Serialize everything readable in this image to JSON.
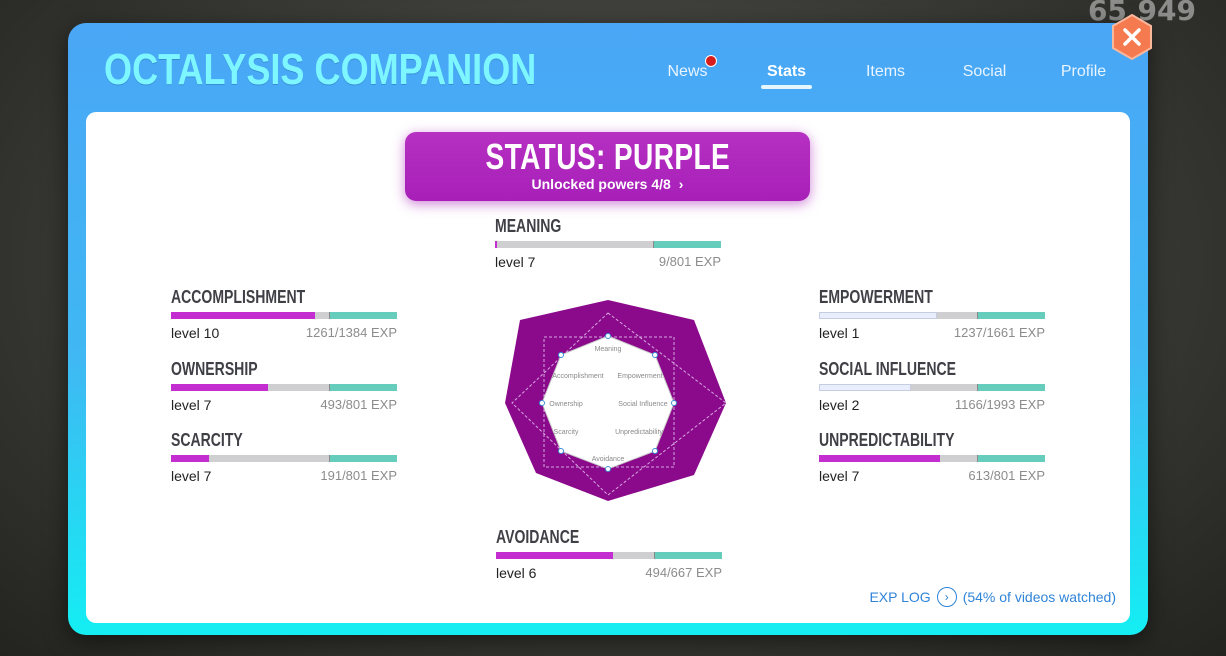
{
  "background": {
    "score": "65,949"
  },
  "header": {
    "title": "OCTALYSIS COMPANION",
    "tabs": [
      {
        "label": "News",
        "notification": true
      },
      {
        "label": "Stats",
        "active": true
      },
      {
        "label": "Items"
      },
      {
        "label": "Social"
      },
      {
        "label": "Profile"
      }
    ],
    "close_icon": "close-icon"
  },
  "status": {
    "title": "STATUS: PURPLE",
    "subtitle": "Unlocked powers 4/8",
    "color": "#b630c2"
  },
  "stats": {
    "meaning": {
      "name": "MEANING",
      "level": "level 7",
      "exp": "9/801 EXP",
      "progress": 0.012
    },
    "accomplishment": {
      "name": "ACCOMPLISHMENT",
      "level": "level 10",
      "exp": "1261/1384 EXP",
      "progress": 0.911
    },
    "ownership": {
      "name": "OWNERSHIP",
      "level": "level 7",
      "exp": "493/801 EXP",
      "progress": 0.615
    },
    "scarcity": {
      "name": "SCARCITY",
      "level": "level 7",
      "exp": "191/801 EXP",
      "progress": 0.238
    },
    "empowerment": {
      "name": "EMPOWERMENT",
      "level": "level 1",
      "exp": "1237/1661 EXP",
      "progress": 0.745
    },
    "social_influence": {
      "name": "SOCIAL INFLUENCE",
      "level": "level 2",
      "exp": "1166/1993 EXP",
      "progress": 0.585
    },
    "unpredictability": {
      "name": "UNPREDICTABILITY",
      "level": "level 7",
      "exp": "613/801 EXP",
      "progress": 0.765
    },
    "avoidance": {
      "name": "AVOIDANCE",
      "level": "level 6",
      "exp": "494/667 EXP",
      "progress": 0.741
    }
  },
  "radar": {
    "labels": {
      "meaning": "Meaning",
      "accomplishment": "Accomplishment",
      "empowerment": "Empowerment",
      "ownership": "Ownership",
      "social_influence": "Social Influence",
      "scarcity": "Scarcity",
      "unpredictability": "Unpredictability",
      "avoidance": "Avoidance"
    },
    "fill_color": "#8b0a8b"
  },
  "footer": {
    "exp_log": "EXP LOG",
    "videos": "(54% of videos watched)"
  }
}
